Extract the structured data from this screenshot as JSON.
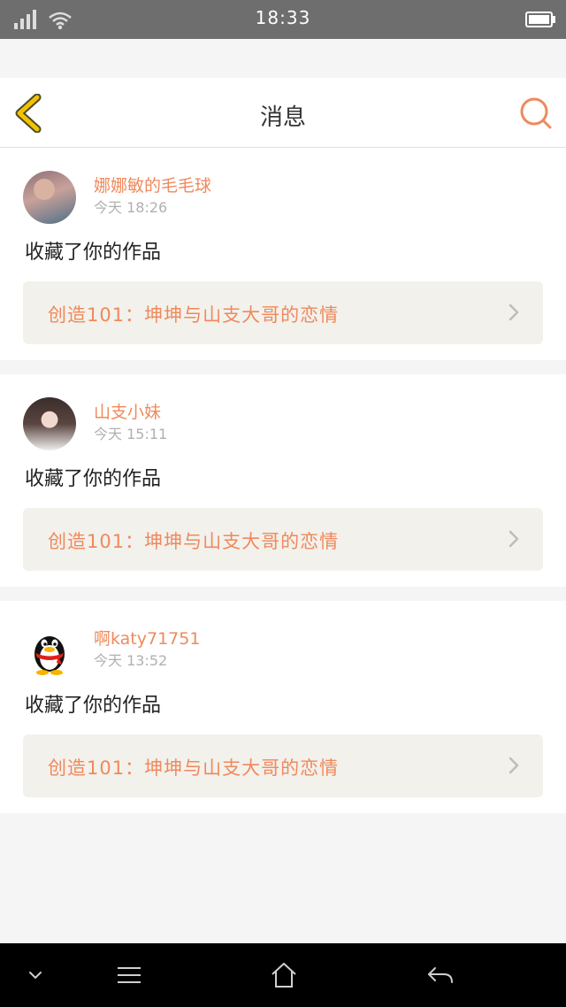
{
  "status_bar": {
    "time": "18:33",
    "signal_icon": "signal-icon",
    "wifi_icon": "wifi-icon",
    "battery_icon": "battery-icon"
  },
  "header": {
    "title": "消息",
    "back_icon": "chevron-left-icon",
    "search_icon": "search-icon"
  },
  "colors": {
    "accent": "#f0895c",
    "back_arrow": "#f2c200",
    "card_bg": "#f2f1ec"
  },
  "messages": [
    {
      "username": "娜娜敏的毛毛球",
      "time": "今天  18:26",
      "action": "收藏了你的作品",
      "work_title": "创造101：坤坤与山支大哥的恋情"
    },
    {
      "username": "山支小妹",
      "time": "今天  15:11",
      "action": "收藏了你的作品",
      "work_title": "创造101：坤坤与山支大哥的恋情"
    },
    {
      "username": "啊katy71751",
      "time": "今天  13:52",
      "action": "收藏了你的作品",
      "work_title": "创造101：坤坤与山支大哥的恋情"
    }
  ],
  "bottom_nav": {
    "icons": [
      "chevron-down-icon",
      "menu-icon",
      "home-icon",
      "back-icon"
    ]
  }
}
